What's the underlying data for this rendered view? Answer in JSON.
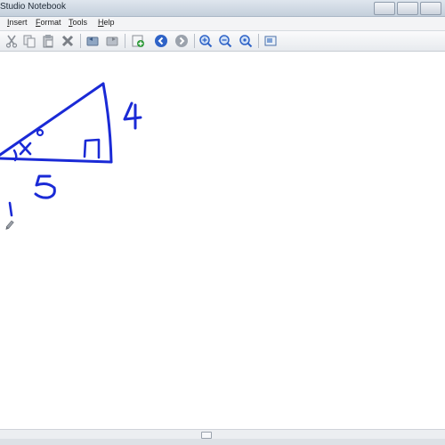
{
  "window": {
    "title": "Studio Notebook"
  },
  "menu": {
    "items": [
      {
        "label": "Insert"
      },
      {
        "label": "Format"
      },
      {
        "label": "Tools"
      },
      {
        "label": "Help"
      }
    ]
  },
  "toolbar": {
    "buttons": [
      {
        "icon": "cut-icon"
      },
      {
        "icon": "copy-icon"
      },
      {
        "icon": "paste-icon"
      },
      {
        "icon": "delete-icon"
      },
      {
        "icon": "undo-icon"
      },
      {
        "icon": "redo-icon"
      },
      {
        "icon": "insert-page-icon"
      },
      {
        "icon": "previous-page-icon"
      },
      {
        "icon": "next-page-icon"
      },
      {
        "icon": "zoom-in-icon"
      },
      {
        "icon": "zoom-out-icon"
      },
      {
        "icon": "zoom-fit-icon"
      },
      {
        "icon": "full-screen-icon"
      }
    ]
  },
  "canvas": {
    "ink_color": "#1a2ad6",
    "handwriting": {
      "side_label": "4",
      "base_label": "5",
      "angle_label": "x°",
      "note": "1"
    }
  }
}
